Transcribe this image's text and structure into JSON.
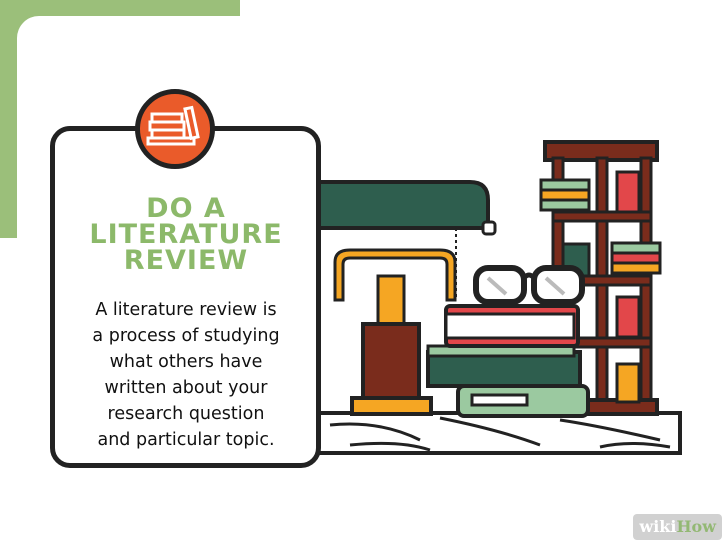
{
  "card": {
    "title_lines": [
      "DO A",
      "LITERATURE",
      "REVIEW"
    ],
    "body_lines": [
      "A literature review is",
      "a process of studying",
      "what others have",
      "written about your",
      "research question",
      "and particular topic."
    ]
  },
  "badge": {
    "icon": "books-icon"
  },
  "watermark": {
    "part1": "wiki",
    "part2": "How"
  },
  "colors": {
    "accent_green": "#8cb96a",
    "badge_orange": "#ea5b2a",
    "lamp_shade": "#2e5e4e",
    "shelf_brown": "#7a2c1c",
    "outline": "#222222"
  }
}
